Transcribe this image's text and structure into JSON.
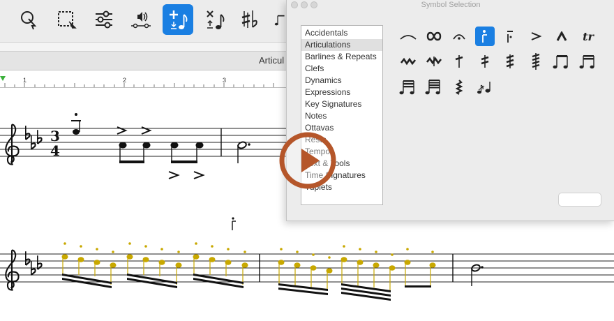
{
  "toolbar": {
    "tools": [
      {
        "icon": "lasso-select-icon"
      },
      {
        "icon": "marquee-select-icon"
      },
      {
        "icon": "mixer-sliders-icon"
      },
      {
        "icon": "speaker-playback-icon"
      },
      {
        "icon": "add-note-icon",
        "active": true
      },
      {
        "icon": "delete-note-icon"
      },
      {
        "icon": "accidentals-icon"
      },
      {
        "icon": "note-partial-icon"
      }
    ]
  },
  "tabbar": {
    "active_tab_label": "Articul"
  },
  "ruler": {
    "marks": [
      "1",
      "2",
      "3"
    ]
  },
  "score": {
    "key_signature": "E-flat major",
    "time_signature": {
      "top": "3",
      "bottom": "4"
    },
    "selection_color": "#c8a800"
  },
  "panel": {
    "title": "Symbol Selection",
    "categories": [
      {
        "label": "Accidentals",
        "selected": false
      },
      {
        "label": "Articulations",
        "selected": true
      },
      {
        "label": "Barlines & Repeats",
        "selected": false
      },
      {
        "label": "Clefs",
        "selected": false
      },
      {
        "label": "Dynamics",
        "selected": false
      },
      {
        "label": "Expressions",
        "selected": false
      },
      {
        "label": "Key Signatures",
        "selected": false
      },
      {
        "label": "Notes",
        "selected": false
      },
      {
        "label": "Ottavas",
        "selected": false
      },
      {
        "label": "Rests",
        "selected": false
      },
      {
        "label": "Tempo",
        "selected": false
      },
      {
        "label": "Text & Tools",
        "selected": false
      },
      {
        "label": "Time Signatures",
        "selected": false
      },
      {
        "label": "Tuplets",
        "selected": false
      }
    ],
    "symbols": [
      {
        "icon": "slur-icon"
      },
      {
        "icon": "turn-icon"
      },
      {
        "icon": "fermata-icon"
      },
      {
        "icon": "staccato-tenuto-icon",
        "selected": true
      },
      {
        "icon": "tenuto-staccato-above-icon"
      },
      {
        "icon": "accent-icon"
      },
      {
        "icon": "marcato-icon"
      },
      {
        "icon": "trill-icon",
        "text": "tr"
      },
      {
        "icon": "mordent-icon"
      },
      {
        "icon": "inverted-mordent-icon"
      },
      {
        "icon": "single-tremolo-icon"
      },
      {
        "icon": "double-tremolo-icon"
      },
      {
        "icon": "triple-tremolo-icon"
      },
      {
        "icon": "quadruple-tremolo-icon"
      },
      {
        "icon": "beamed-eighths-icon"
      },
      {
        "icon": "beamed-sixteenths-icon"
      },
      {
        "icon": "beamed-32nds-icon"
      },
      {
        "icon": "beamed-64ths-icon"
      },
      {
        "icon": "arpeggio-icon"
      },
      {
        "icon": "grace-note-icon"
      }
    ]
  },
  "overlay": {
    "icon": "play-video-icon",
    "color": "#b5562a"
  }
}
